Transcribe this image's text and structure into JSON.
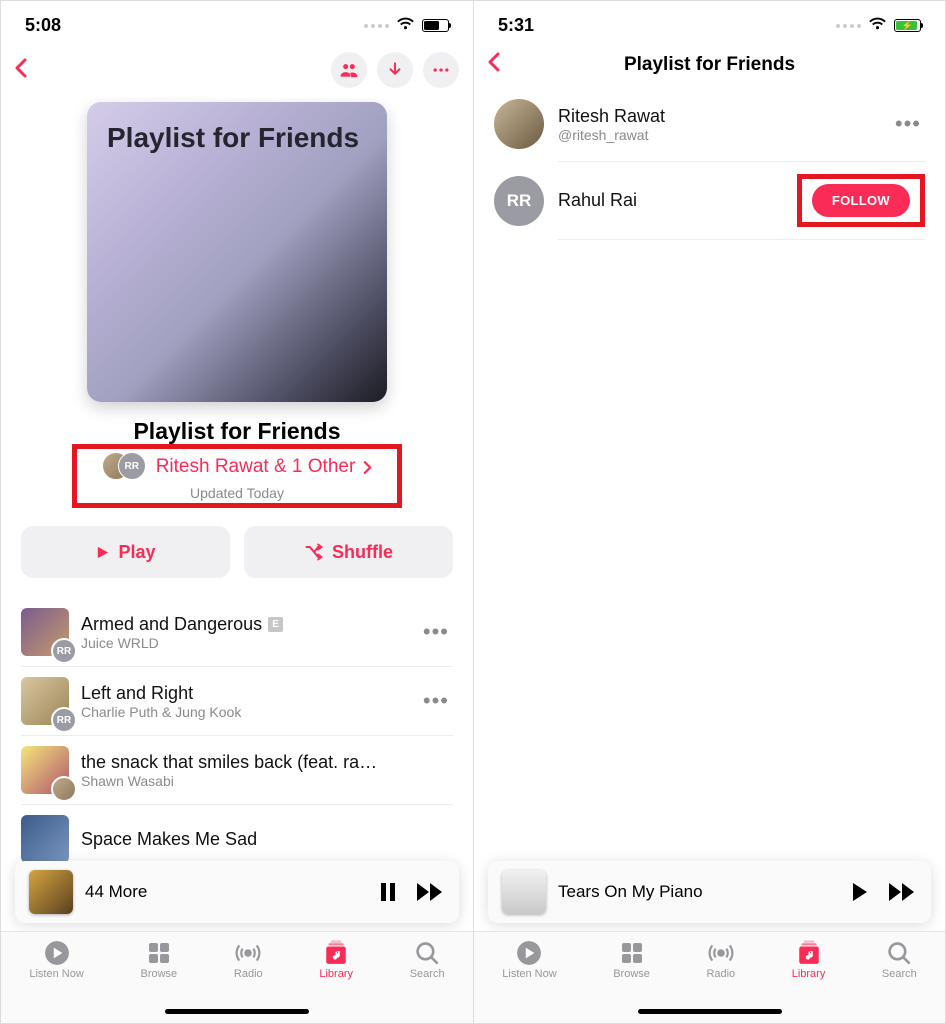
{
  "left": {
    "status": {
      "time": "5:08"
    },
    "playlist": {
      "art_title": "Playlist for Friends",
      "title": "Playlist for Friends",
      "contributors": "Ritesh Rawat & 1 Other",
      "contributor_initials": "RR",
      "updated": "Updated Today",
      "play_label": "Play",
      "shuffle_label": "Shuffle"
    },
    "tracks": [
      {
        "title": "Armed and Dangerous",
        "artist": "Juice WRLD",
        "explicit": true,
        "av": "RR"
      },
      {
        "title": "Left and Right",
        "artist": "Charlie Puth & Jung Kook",
        "explicit": false,
        "av": "RR"
      },
      {
        "title": "the snack that smiles back (feat. ra…",
        "artist": "Shawn Wasabi",
        "explicit": false,
        "av": "photo"
      },
      {
        "title": "Space Makes Me Sad",
        "artist": "",
        "explicit": false,
        "av": ""
      }
    ],
    "now_playing": {
      "title": "44 More"
    }
  },
  "right": {
    "status": {
      "time": "5:31"
    },
    "nav_title": "Playlist for Friends",
    "people": [
      {
        "name": "Ritesh Rawat",
        "handle": "@ritesh_rawat",
        "initials": "",
        "action": "more"
      },
      {
        "name": "Rahul Rai",
        "handle": "",
        "initials": "RR",
        "action": "follow"
      }
    ],
    "follow_label": "FOLLOW",
    "now_playing": {
      "title": "Tears On My Piano"
    }
  },
  "tabs": {
    "listen": "Listen Now",
    "browse": "Browse",
    "radio": "Radio",
    "library": "Library",
    "search": "Search"
  },
  "explicit_badge": "E"
}
